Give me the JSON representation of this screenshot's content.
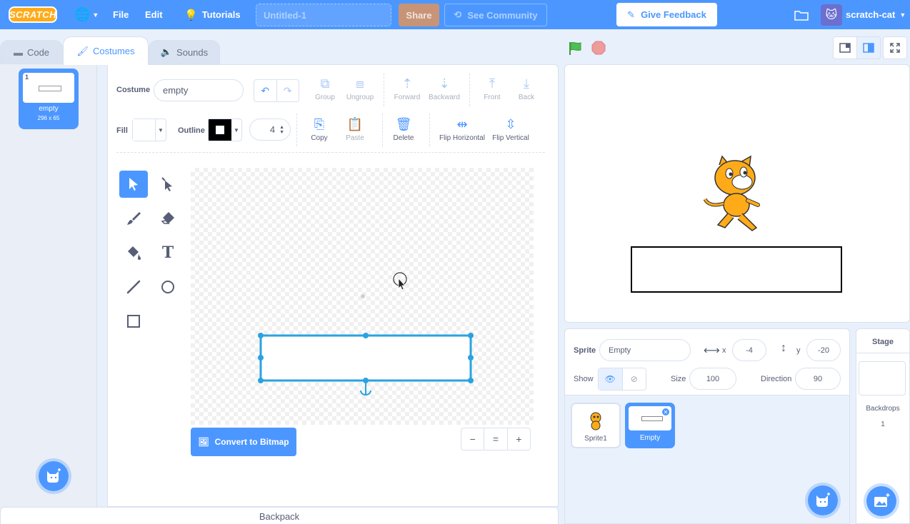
{
  "menu": {
    "logo": "SCRATCH",
    "file": "File",
    "edit": "Edit",
    "tutorials": "Tutorials",
    "project_title": "Untitled-1",
    "share": "Share",
    "see_community": "See Community",
    "give_feedback": "Give Feedback",
    "username": "scratch-cat"
  },
  "tabs": {
    "code": "Code",
    "costumes": "Costumes",
    "sounds": "Sounds"
  },
  "costume_list": [
    {
      "number": "1",
      "name": "empty",
      "size": "296 x 65"
    }
  ],
  "paint_editor": {
    "costume_label": "Costume",
    "costume_name": "empty",
    "group": "Group",
    "ungroup": "Ungroup",
    "forward": "Forward",
    "backward": "Backward",
    "front": "Front",
    "back": "Back",
    "fill_label": "Fill",
    "outline_label": "Outline",
    "outline_width": "4",
    "copy": "Copy",
    "paste": "Paste",
    "delete": "Delete",
    "flip_horizontal": "Flip Horizontal",
    "flip_vertical": "Flip Vertical",
    "convert_button": "Convert to Bitmap",
    "zoom_out": "−",
    "zoom_reset": "=",
    "zoom_in": "+"
  },
  "backpack": "Backpack",
  "sprite_info": {
    "sprite_label": "Sprite",
    "sprite_name": "Empty",
    "x_label": "x",
    "x_value": "-4",
    "y_label": "y",
    "y_value": "-20",
    "show_label": "Show",
    "size_label": "Size",
    "size_value": "100",
    "direction_label": "Direction",
    "direction_value": "90"
  },
  "sprites": [
    {
      "name": "Sprite1"
    },
    {
      "name": "Empty"
    }
  ],
  "stage_panel": {
    "title": "Stage",
    "backdrops_label": "Backdrops",
    "backdrops_count": "1"
  },
  "colors": {
    "accent": "#4c97ff",
    "background": "#e8f0fc",
    "cat_orange": "#ffab19",
    "stop_red": "#ec9c9c"
  }
}
